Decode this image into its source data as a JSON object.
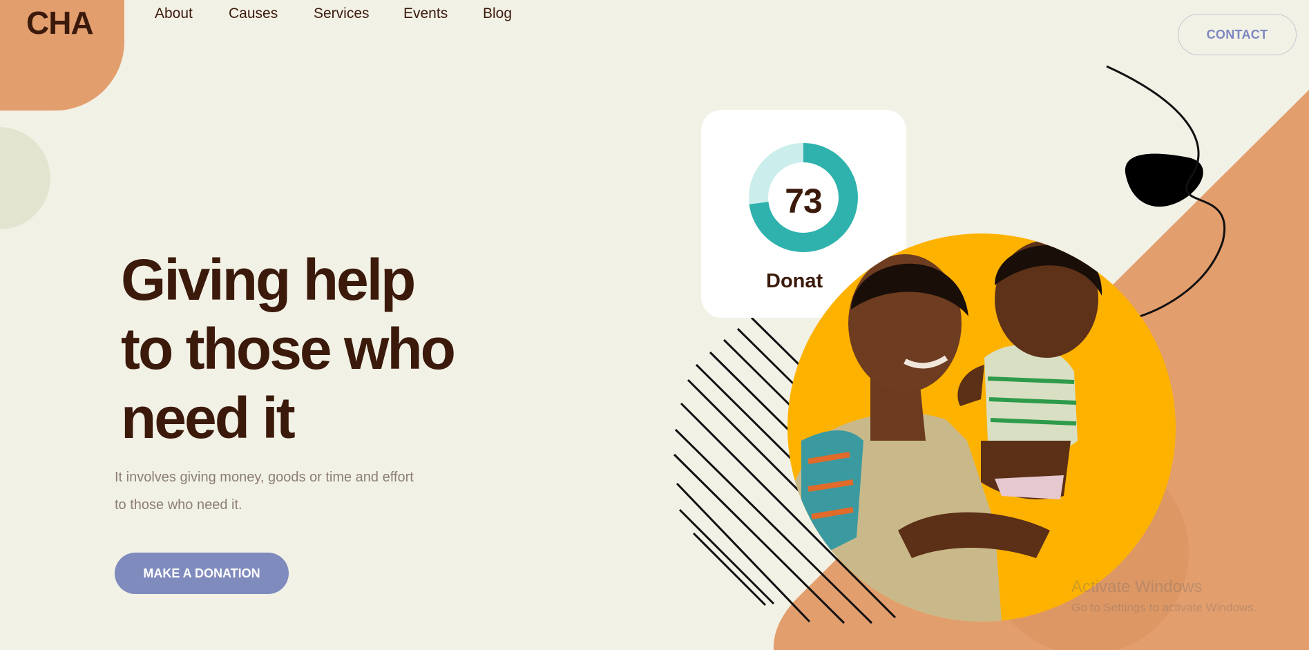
{
  "brand": {
    "logo": "CHA"
  },
  "nav": {
    "items": [
      {
        "label": "About"
      },
      {
        "label": "Causes"
      },
      {
        "label": "Services"
      },
      {
        "label": "Events"
      },
      {
        "label": "Blog"
      }
    ],
    "contact_label": "CONTACT"
  },
  "hero": {
    "title_lines": [
      "Giving help",
      "to those who",
      "need it"
    ],
    "subtitle_lines": [
      "It involves giving money, goods or time and effort",
      "to those who need it."
    ],
    "cta_label": "MAKE A DONATION"
  },
  "donation_card": {
    "progress_value": "73",
    "progress_fraction": 0.73,
    "label": "Donat"
  },
  "watermark": {
    "title": "Activate Windows",
    "subtitle": "Go to Settings to activate Windows."
  },
  "colors": {
    "background": "#f2f1e6",
    "text_dark": "#3b1a0b",
    "accent_orange": "#e39e6e",
    "accent_yellow": "#feb200",
    "accent_teal": "#2fb2ad",
    "accent_teal_light": "#cbeeec",
    "button_blue": "#7f8bbd"
  },
  "icons": {
    "progress": "donut-progress-ring",
    "people": "mother-and-child-photo"
  }
}
